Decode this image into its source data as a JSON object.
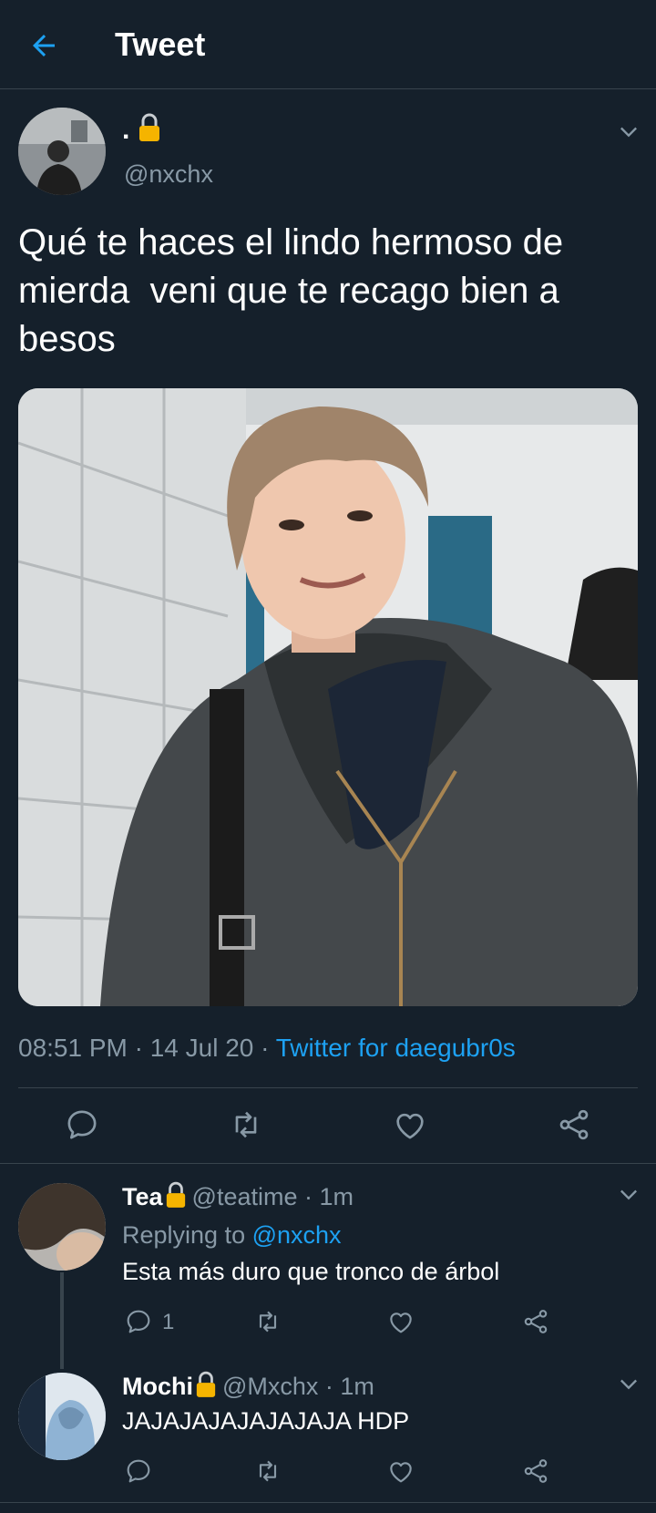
{
  "header": {
    "title": "Tweet"
  },
  "tweet": {
    "display_name": ".",
    "username": "@nxchx",
    "text": "Qué te haces el lindo hermoso de mierda  veni que te recago bien a besos",
    "time": "08:51 PM · 14 Jul 20 · ",
    "source": "Twitter for daegubr0s"
  },
  "replies": [
    {
      "name": "Tea",
      "handle": "@teatime · 1m",
      "replying_prefix": "Replying to ",
      "replying_to": "@nxchx",
      "text": "Esta más duro que tronco de árbol",
      "reply_count": "1"
    },
    {
      "name": "Mochi",
      "handle": "@Mxchx · 1m",
      "text": "JAJAJAJAJAJAJAJA HDP"
    }
  ],
  "colors": {
    "background": "#15202b",
    "accent": "#1da1f2",
    "muted": "#8899a6",
    "lock": "#f5b400"
  }
}
